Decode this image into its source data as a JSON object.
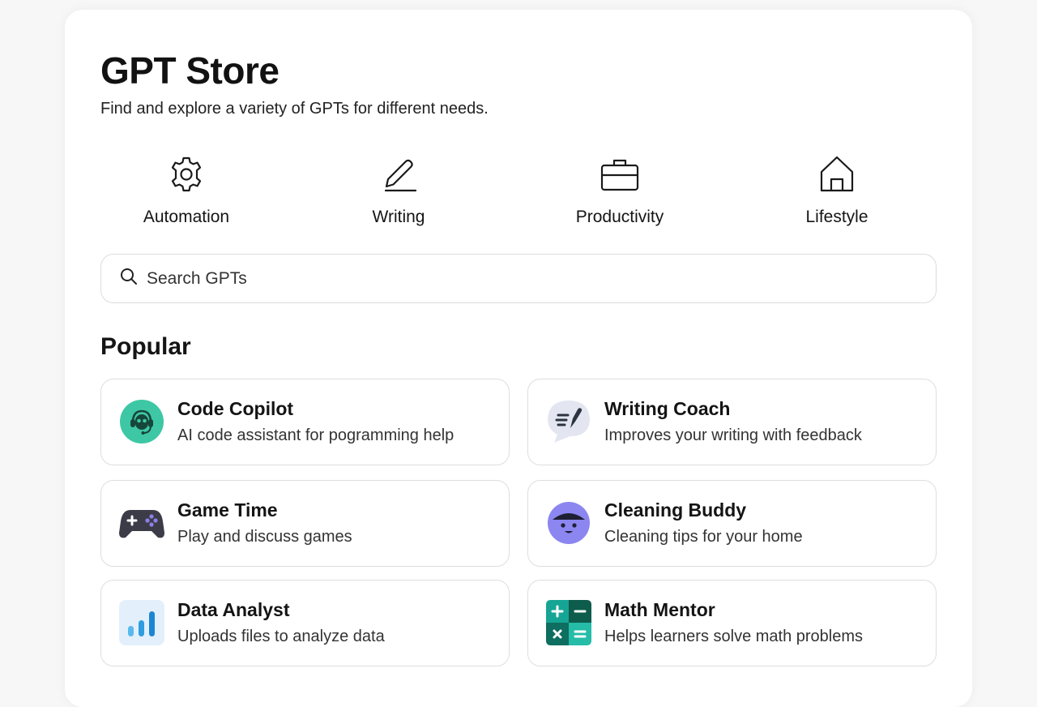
{
  "header": {
    "title": "GPT Store",
    "subtitle": "Find and explore a variety of GPTs for different needs."
  },
  "categories": [
    {
      "label": "Automation",
      "icon": "gear-icon"
    },
    {
      "label": "Writing",
      "icon": "pencil-icon"
    },
    {
      "label": "Productivity",
      "icon": "briefcase-icon"
    },
    {
      "label": "Lifestyle",
      "icon": "home-icon"
    }
  ],
  "search": {
    "placeholder": "Search GPTs",
    "value": ""
  },
  "popular": {
    "heading": "Popular",
    "items": [
      {
        "title": "Code Copilot",
        "description": "AI code assistant for pogramming help",
        "icon": "robot-headset-icon",
        "color": "#3ec7a4"
      },
      {
        "title": "Writing Coach",
        "description": "Improves your writing with feedback",
        "icon": "chat-pen-icon",
        "color": "#e3e6f0"
      },
      {
        "title": "Game Time",
        "description": "Play and discuss games",
        "icon": "gamepad-icon",
        "color": "#3b3c48"
      },
      {
        "title": "Cleaning Buddy",
        "description": "Cleaning tips for your home",
        "icon": "cleaning-face-icon",
        "color": "#8b86f0"
      },
      {
        "title": "Data Analyst",
        "description": "Uploads files to analyze data",
        "icon": "bar-chart-icon",
        "color": "#2f9de0"
      },
      {
        "title": "Math Mentor",
        "description": "Helps learners solve math problems",
        "icon": "calculator-icon",
        "color": "#14806f"
      }
    ]
  },
  "colors": {
    "page_background": "#f7f7f7",
    "panel_background": "#ffffff",
    "border": "#dedede",
    "text": "#141414"
  }
}
